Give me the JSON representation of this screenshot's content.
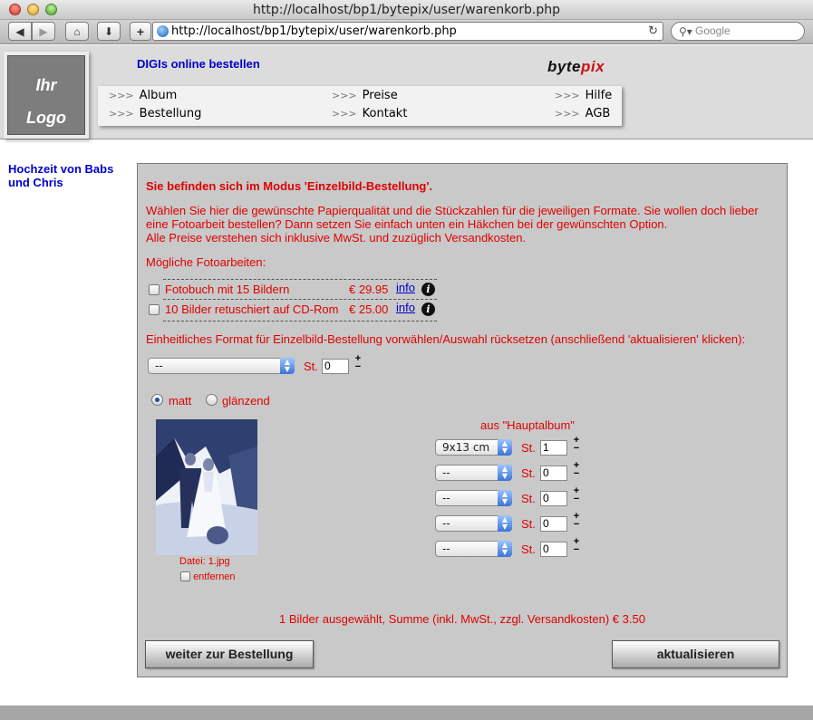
{
  "browser": {
    "window_title": "http://localhost/bp1/bytepix/user/warenkorb.php",
    "url": "http://localhost/bp1/bytepix/user/warenkorb.php",
    "search_placeholder": "Google"
  },
  "header": {
    "logo_line1": "Ihr",
    "logo_line2": "Logo",
    "slogan": "DIGIs online bestellen",
    "brand_left": "byte",
    "brand_right": "pix",
    "nav_prefix": ">>>",
    "nav": {
      "album": "Album",
      "preise": "Preise",
      "hilfe": "Hilfe",
      "bestellung": "Bestellung",
      "kontakt": "Kontakt",
      "agb": "AGB"
    }
  },
  "sidebar": {
    "album_title": "Hochzeit von Babs und Chris"
  },
  "main": {
    "heading": "Sie befinden sich im Modus 'Einzelbild-Bestellung'.",
    "intro_line1": "Wählen Sie hier die gewünschte Papierqualität und die Stückzahlen für die jeweiligen Formate. Sie wollen doch lieber eine Fotoarbeit bestellen? Dann setzen Sie einfach unten ein Häkchen bei der gewünschten Option.",
    "intro_line2": "Alle Preise verstehen sich inklusive MwSt. und zuzüglich Versandkosten.",
    "moegliche_label": "Mögliche Fotoarbeiten:",
    "options": [
      {
        "label": "Fotobuch mit 15 Bildern",
        "price": "€ 29.95",
        "info": "info"
      },
      {
        "label": "10 Bilder retuschiert auf CD-Rom",
        "price": "€ 25.00",
        "info": "info"
      }
    ],
    "einheitlich_label": "Einheitliches Format für Einzelbild-Bestellung vorwählen/Auswahl rücksetzen (anschließend 'aktualisieren' klicken):",
    "global_format": "--",
    "st_label": "St.",
    "global_qty": "0",
    "paper": {
      "matt": "matt",
      "glaenzend": "glänzend",
      "selected": "matt"
    },
    "photo": {
      "caption": "Datei:  1.jpg",
      "remove_label": "entfernen",
      "source": "aus \"Hauptalbum\""
    },
    "formats": [
      {
        "format": "9x13 cm",
        "qty": "1"
      },
      {
        "format": "--",
        "qty": "0"
      },
      {
        "format": "--",
        "qty": "0"
      },
      {
        "format": "--",
        "qty": "0"
      },
      {
        "format": "--",
        "qty": "0"
      }
    ],
    "summary": "1 Bilder ausgewählt, Summe (inkl. MwSt., zzgl. Versandkosten) € 3.50",
    "button_weiter": "weiter zur Bestellung",
    "button_aktualisieren": "aktualisieren"
  },
  "colors": {
    "accent_red": "#e00000",
    "link_blue": "#0000cc",
    "panel_gray": "#c9c9c9"
  }
}
